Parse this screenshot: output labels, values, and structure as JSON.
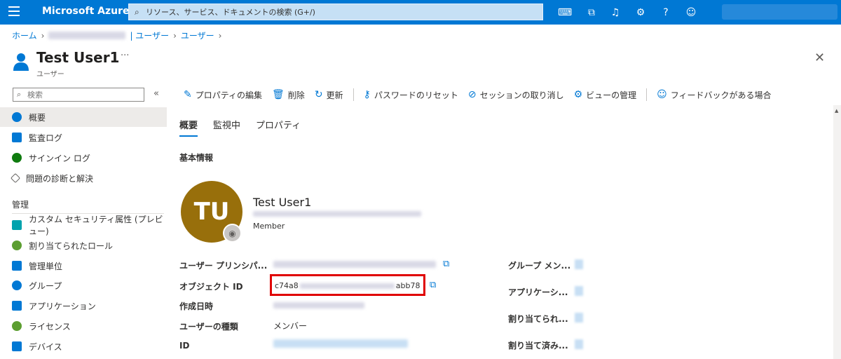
{
  "topbar": {
    "brand": "Microsoft Azure",
    "search_placeholder": "リソース、サービス、ドキュメントの検索 (G+/)",
    "icons": [
      "cloud-shell-icon",
      "directory-filter-icon",
      "notification-bell-icon",
      "settings-gear-icon",
      "help-icon",
      "feedback-icon"
    ]
  },
  "breadcrumb": {
    "home": "ホーム",
    "item2": "| ユーザー",
    "item3": "ユーザー"
  },
  "header": {
    "title": "Test User1",
    "subtitle": "ユーザー",
    "more": "···",
    "close": "✕"
  },
  "sidebar": {
    "search_placeholder": "検索",
    "collapse": "«",
    "items": [
      {
        "label": "概要",
        "color": "#0078d4"
      },
      {
        "label": "監査ログ",
        "color": "#0078d4"
      },
      {
        "label": "サインイン ログ",
        "color": "#0f7b0f"
      },
      {
        "label": "問題の診断と解決",
        "color": "#605e5c"
      }
    ],
    "group_label": "管理",
    "manage_items": [
      {
        "label": "カスタム セキュリティ属性 (プレビュー)",
        "color": "#00a2ad"
      },
      {
        "label": "割り当てられたロール",
        "color": "#5c9e31"
      },
      {
        "label": "管理単位",
        "color": "#0078d4"
      },
      {
        "label": "グループ",
        "color": "#0078d4"
      },
      {
        "label": "アプリケーション",
        "color": "#0078d4"
      },
      {
        "label": "ライセンス",
        "color": "#5c9e31"
      },
      {
        "label": "デバイス",
        "color": "#0078d4"
      }
    ]
  },
  "toolbar": {
    "edit": "プロパティの編集",
    "delete": "削除",
    "refresh": "更新",
    "reset_password": "パスワードのリセット",
    "revoke_sessions": "セッションの取り消し",
    "manage_view": "ビューの管理",
    "feedback": "フィードバックがある場合"
  },
  "tabs": [
    "概要",
    "監視中",
    "プロパティ"
  ],
  "section_title": "基本情報",
  "profile": {
    "initials": "TU",
    "name": "Test User1",
    "type": "Member"
  },
  "properties": {
    "upn_label": "ユーザー プリンシパ...",
    "object_id_label": "オブジェクト ID",
    "object_id_prefix": "c74a8",
    "object_id_suffix": "abb78",
    "created_label": "作成日時",
    "user_type_label": "ユーザーの種類",
    "user_type_value": "メンバー",
    "id_label": "ID"
  },
  "right_props": {
    "group": "グループ メン...",
    "apps": "アプリケーシ...",
    "roles": "割り当てられ...",
    "licenses": "割り当て済み..."
  },
  "colors": {
    "accent": "#0078d4",
    "avatar": "#986f0b",
    "highlight": "#e00000"
  }
}
